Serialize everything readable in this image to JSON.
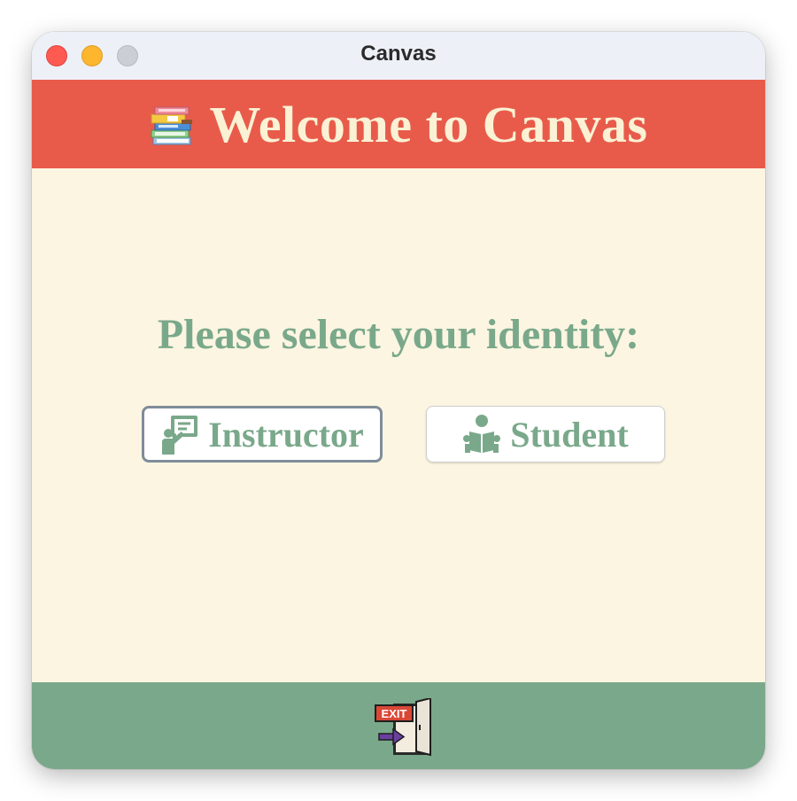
{
  "window": {
    "title": "Canvas"
  },
  "header": {
    "title": "Welcome to Canvas",
    "icon": "books-icon"
  },
  "main": {
    "prompt": "Please select your identity:",
    "buttons": [
      {
        "label": "Instructor",
        "icon": "instructor-icon",
        "selected": true
      },
      {
        "label": "Student",
        "icon": "student-reading-icon",
        "selected": false
      }
    ]
  },
  "footer": {
    "exit_icon": "exit-door-icon",
    "exit_sign_text": "EXIT"
  },
  "colors": {
    "header_bg": "#e85b4a",
    "header_text": "#fbf1d4",
    "content_bg": "#fbf5e1",
    "accent_green": "#7aa88a",
    "footer_bg": "#7aa88a",
    "selected_border": "#7f8c99"
  }
}
